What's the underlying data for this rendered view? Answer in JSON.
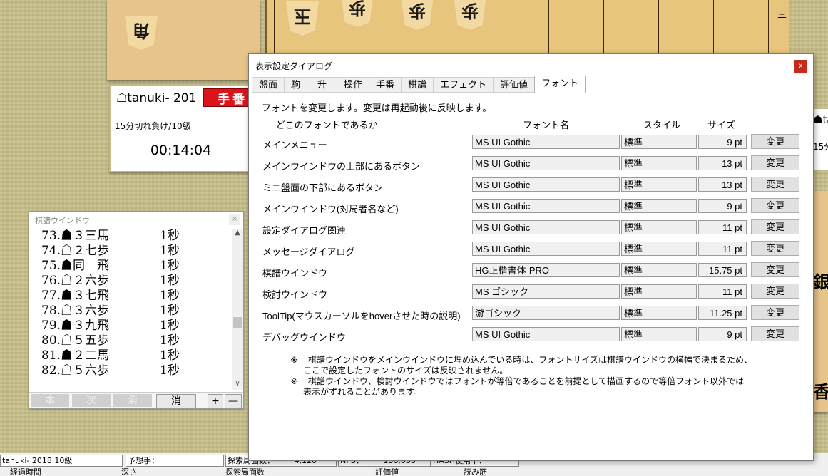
{
  "board": {
    "top_pieces": [
      "玉",
      "歩",
      "歩",
      "歩"
    ],
    "komadai_piece": "角",
    "rank_label": "三",
    "right_pieces": [
      "銀",
      "香"
    ]
  },
  "player_panel": {
    "name": "☖tanuki- 201",
    "teban_label": "手番",
    "info": "15分切れ負け/10級",
    "timer": "00:14:04"
  },
  "right_panel": {
    "name_partial": "☗ta",
    "info_partial": "15分"
  },
  "kifu_window": {
    "title": "棋譜ウインドウ",
    "close": "×",
    "rows": [
      {
        "move": "73.☗３三馬",
        "time": "1秒"
      },
      {
        "move": "74.☖２七歩",
        "time": "1秒"
      },
      {
        "move": "75.☗同　飛",
        "time": "1秒"
      },
      {
        "move": "76.☖２六歩",
        "time": "1秒"
      },
      {
        "move": "77.☗３七飛",
        "time": "1秒"
      },
      {
        "move": "78.☖３六歩",
        "time": "1秒"
      },
      {
        "move": "79.☗３九飛",
        "time": "1秒"
      },
      {
        "move": "80.☖５五歩",
        "time": "1秒"
      },
      {
        "move": "81.☗２二馬",
        "time": "1秒"
      },
      {
        "move": "82.☖５六歩",
        "time": "1秒"
      }
    ],
    "buttons": [
      "本",
      "次",
      "消",
      "消",
      "+",
      "—"
    ],
    "scroll_up": "▲",
    "scroll_down": "∨"
  },
  "status_bar": {
    "player": "tanuki- 2018 10級",
    "prediction": "予想手：",
    "search_nodes": "探索局面数：　　　4,120",
    "nps": "NPS：　　　136,033",
    "hash": "HASH使用率：",
    "row2_a": "経過時間",
    "row2_b": "深さ",
    "row2_c": "探索局面数",
    "row2_d": "評価値",
    "row2_e": "読み筋"
  },
  "dialog": {
    "title": "表示設定ダイアログ",
    "close": "x",
    "tabs": [
      "盤面",
      "駒",
      "升",
      "操作",
      "手番",
      "棋譜",
      "エフェクト",
      "評価値",
      "フォント"
    ],
    "active_tab": "フォント",
    "description": "フォントを変更します。変更は再起動後に反映します。",
    "headers": {
      "where": "どこのフォントであるか",
      "font_name": "フォント名",
      "style": "スタイル",
      "size": "サイズ"
    },
    "rows": [
      {
        "label": "メインメニュー",
        "font": "MS UI Gothic",
        "style": "標準",
        "size": "9 pt",
        "button": "変更"
      },
      {
        "label": "メインウインドウの上部にあるボタン",
        "font": "MS UI Gothic",
        "style": "標準",
        "size": "13 pt",
        "button": "変更"
      },
      {
        "label": "ミニ盤面の下部にあるボタン",
        "font": "MS UI Gothic",
        "style": "標準",
        "size": "13 pt",
        "button": "変更"
      },
      {
        "label": "メインウインドウ(対局者名など)",
        "font": "MS UI Gothic",
        "style": "標準",
        "size": "9 pt",
        "button": "変更"
      },
      {
        "label": "設定ダイアログ関連",
        "font": "MS UI Gothic",
        "style": "標準",
        "size": "11 pt",
        "button": "変更"
      },
      {
        "label": "メッセージダイアログ",
        "font": "MS UI Gothic",
        "style": "標準",
        "size": "11 pt",
        "button": "変更"
      },
      {
        "label": "棋譜ウインドウ",
        "font": "HG正楷書体-PRO",
        "style": "標準",
        "size": "15.75 pt",
        "button": "変更"
      },
      {
        "label": "検討ウインドウ",
        "font": "MS ゴシック",
        "style": "標準",
        "size": "11 pt",
        "button": "変更"
      },
      {
        "label": "ToolTip(マウスカーソルをhoverさせた時の説明)",
        "font": "游ゴシック",
        "style": "標準",
        "size": "11.25 pt",
        "button": "変更"
      },
      {
        "label": "デバッグウインドウ",
        "font": "MS UI Gothic",
        "style": "標準",
        "size": "9 pt",
        "button": "変更"
      }
    ],
    "notes": [
      {
        "mark": "※",
        "line1": "棋譜ウインドウをメインウインドウに埋め込んでいる時は、フォントサイズは棋譜ウインドウの横幅で決まるため、",
        "line2": "ここで設定したフォントのサイズは反映されません。"
      },
      {
        "mark": "※",
        "line1": "棋譜ウインドウ、検討ウインドウではフォントが等倍であることを前提として描画するので等倍フォント以外では",
        "line2": "表示がずれることがあります。"
      }
    ]
  }
}
